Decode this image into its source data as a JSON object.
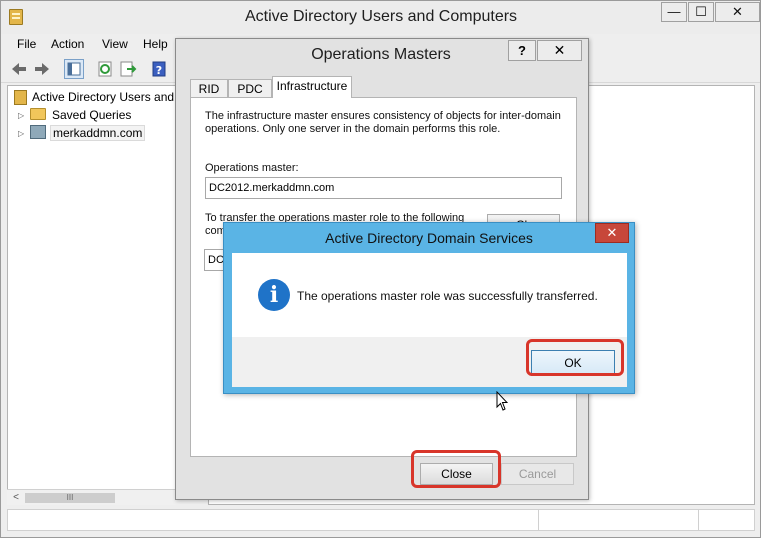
{
  "main_window": {
    "title": "Active Directory Users and Computers",
    "caption_buttons": {
      "minimize": "—",
      "maximize": "☐",
      "close": "✕"
    }
  },
  "menu": [
    "File",
    "Action",
    "View",
    "Help"
  ],
  "toolbar": {
    "icons": [
      "back-arrow-icon",
      "forward-arrow-icon",
      "console-tree-icon",
      "refresh-icon",
      "export-list-icon",
      "help-icon"
    ]
  },
  "tree": {
    "root": "Active Directory Users and C",
    "saved_queries": "Saved Queries",
    "domain": "merkaddmn.com"
  },
  "tree_scrollbar": {
    "left_arrow": "<",
    "thumb_grip": "III"
  },
  "ops_dialog": {
    "title": "Operations Masters",
    "help_button": "?",
    "close_button": "✕",
    "tabs": [
      "RID",
      "PDC",
      "Infrastructure"
    ],
    "active_tab": "Infrastructure",
    "description": "The infrastructure master ensures consistency of objects for inter-domain operations. Only one server in the domain performs this role.",
    "operations_master_label": "Operations master:",
    "operations_master_value": "DC2012.merkaddmn.com",
    "transfer_label_line1": "To transfer the operations master role to the following",
    "transfer_label_line2": "com",
    "transfer_target_value": "DC",
    "change_button": "Ch",
    "close_btn": "Close",
    "cancel_btn": "Cancel"
  },
  "msg_dialog": {
    "title": "Active Directory Domain Services",
    "close_button": "✕",
    "icon": "information-icon",
    "icon_glyph": "i",
    "message": "The operations master role was successfully transferred.",
    "ok_button": "OK"
  },
  "colors": {
    "highlight": "#d8352a",
    "msg_titlebar": "#5ab4e5",
    "msg_close": "#c7473a",
    "info_icon": "#1f73c8"
  }
}
